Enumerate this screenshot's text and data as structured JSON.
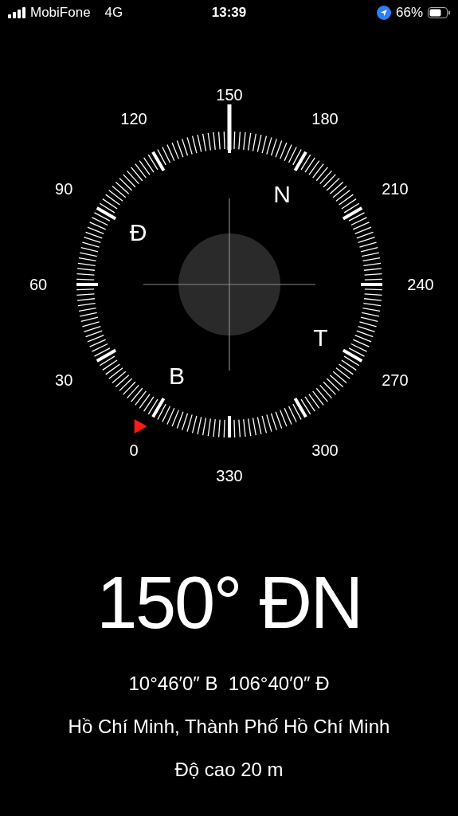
{
  "status_bar": {
    "carrier": "MobiFone",
    "network": "4G",
    "time": "13:39",
    "battery": "66%"
  },
  "compass": {
    "dial_labels": [
      "150",
      "180",
      "210",
      "240",
      "270",
      "300",
      "330",
      "0",
      "30",
      "60",
      "90",
      "120"
    ],
    "cardinals": [
      "N",
      "T",
      "B",
      "Đ"
    ]
  },
  "heading": "150° ĐN",
  "coordinates": "10°46′0″ B  106°40′0″ Đ",
  "place": "Hồ Chí Minh, Thành Phố Hồ Chí Minh",
  "altitude": "Độ cao 20 m"
}
